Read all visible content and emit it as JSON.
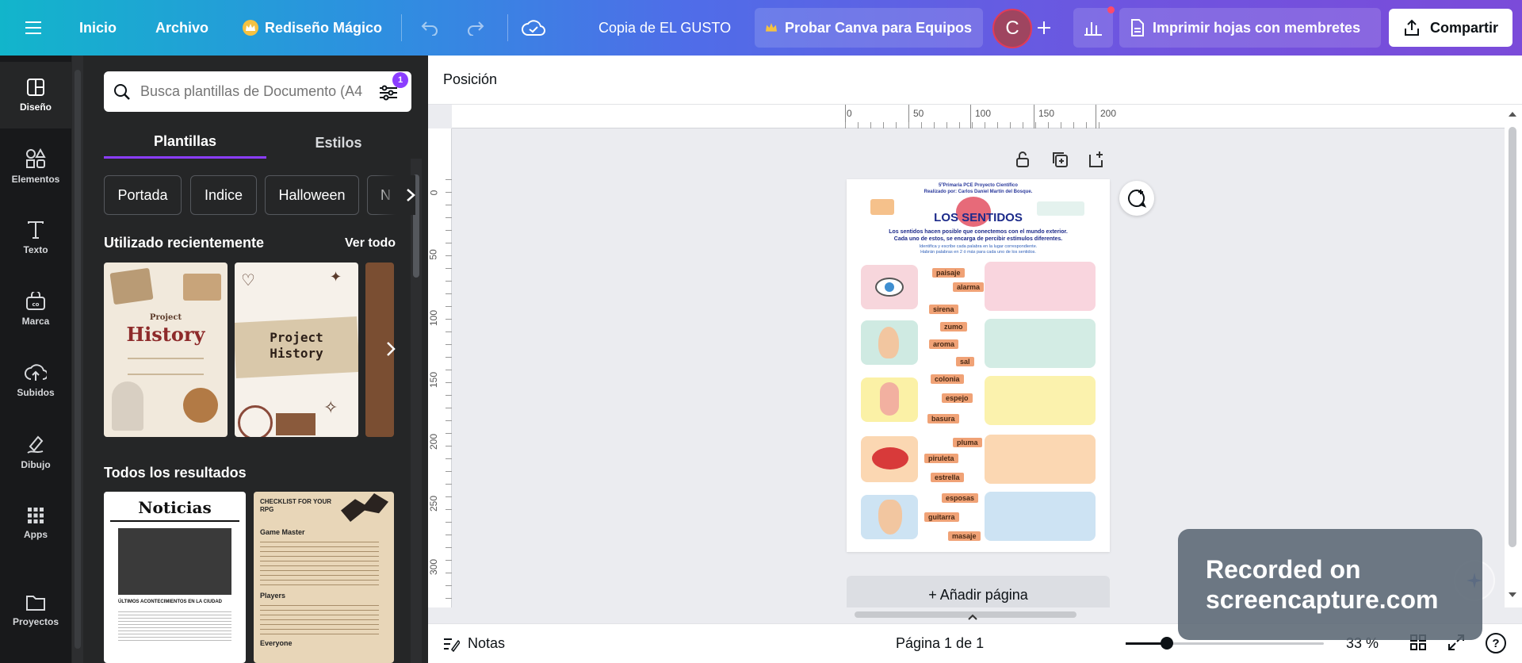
{
  "topbar": {
    "home": "Inicio",
    "file": "Archivo",
    "magic": "Rediseño Mágico",
    "doc_title": "Copia de EL GUSTO",
    "teams": "Probar Canva para Equipos",
    "avatar_letter": "C",
    "print": "Imprimir hojas con membretes",
    "share": "Compartir"
  },
  "rail": [
    {
      "label": "Diseño",
      "icon": "layout-icon"
    },
    {
      "label": "Elementos",
      "icon": "shapes-icon"
    },
    {
      "label": "Texto",
      "icon": "text-icon"
    },
    {
      "label": "Marca",
      "icon": "brand-icon"
    },
    {
      "label": "Subidos",
      "icon": "upload-icon"
    },
    {
      "label": "Dibujo",
      "icon": "draw-icon"
    },
    {
      "label": "Apps",
      "icon": "apps-icon"
    },
    {
      "label": "Proyectos",
      "icon": "folder-icon"
    }
  ],
  "panel": {
    "search_placeholder": "Busca plantillas de Documento (A4",
    "filter_badge": "1",
    "tab_templates": "Plantillas",
    "tab_styles": "Estilos",
    "chips": [
      "Portada",
      "Indice",
      "Halloween",
      "N"
    ],
    "recent_title": "Utilizado recientemente",
    "see_all": "Ver todo",
    "all_results_title": "Todos los resultados",
    "thumb1": {
      "line1": "Project",
      "line2": "History"
    },
    "thumb2": {
      "line1": "Project",
      "line2": "History"
    },
    "result1": {
      "title": "Noticias",
      "heading": "ÚLTIMOS ACONTECIMIENTOS EN LA CIUDAD"
    },
    "result2": {
      "title": "CHECKLIST FOR YOUR RPG",
      "section1": "Game Master",
      "section2": "Players",
      "section3": "Everyone"
    }
  },
  "editor": {
    "position_label": "Posición",
    "ruler_h": [
      "0",
      "50",
      "100",
      "150",
      "200"
    ],
    "ruler_v": [
      "0",
      "50",
      "100",
      "150",
      "200",
      "250",
      "300"
    ],
    "add_page": "+ Añadir página",
    "notes": "Notas",
    "page_indicator": "Página 1 de 1",
    "zoom": "33 %",
    "help": "?"
  },
  "document": {
    "header1": "5ºPrimaria PCE Proyecto Científico",
    "header2": "Realizado por: Carlos Daniel Martín del Bosque.",
    "title": "LOS SENTIDOS",
    "intro1": "Los sentidos hacen posible que conectemos con el mundo exterior.",
    "intro2": "Cada uno de estos, se encarga de percibir estímulos diferentes.",
    "instruction1": "Identifica y escribe cada palabra en la lugar correspondiente.",
    "instruction2": "Habrán palabras en 2 ó más para cada uno de los sentidos.",
    "words": [
      "paisaje",
      "alarma",
      "sirena",
      "zumo",
      "aroma",
      "sal",
      "colonia",
      "espejo",
      "basura",
      "pluma",
      "piruleta",
      "estrella",
      "esposas",
      "guitarra",
      "masaje"
    ]
  },
  "watermark": {
    "line1": "Recorded on",
    "line2": "screencapture.com"
  },
  "colors": {
    "accent": "#8b3dff",
    "share_bg": "#ffffff"
  }
}
